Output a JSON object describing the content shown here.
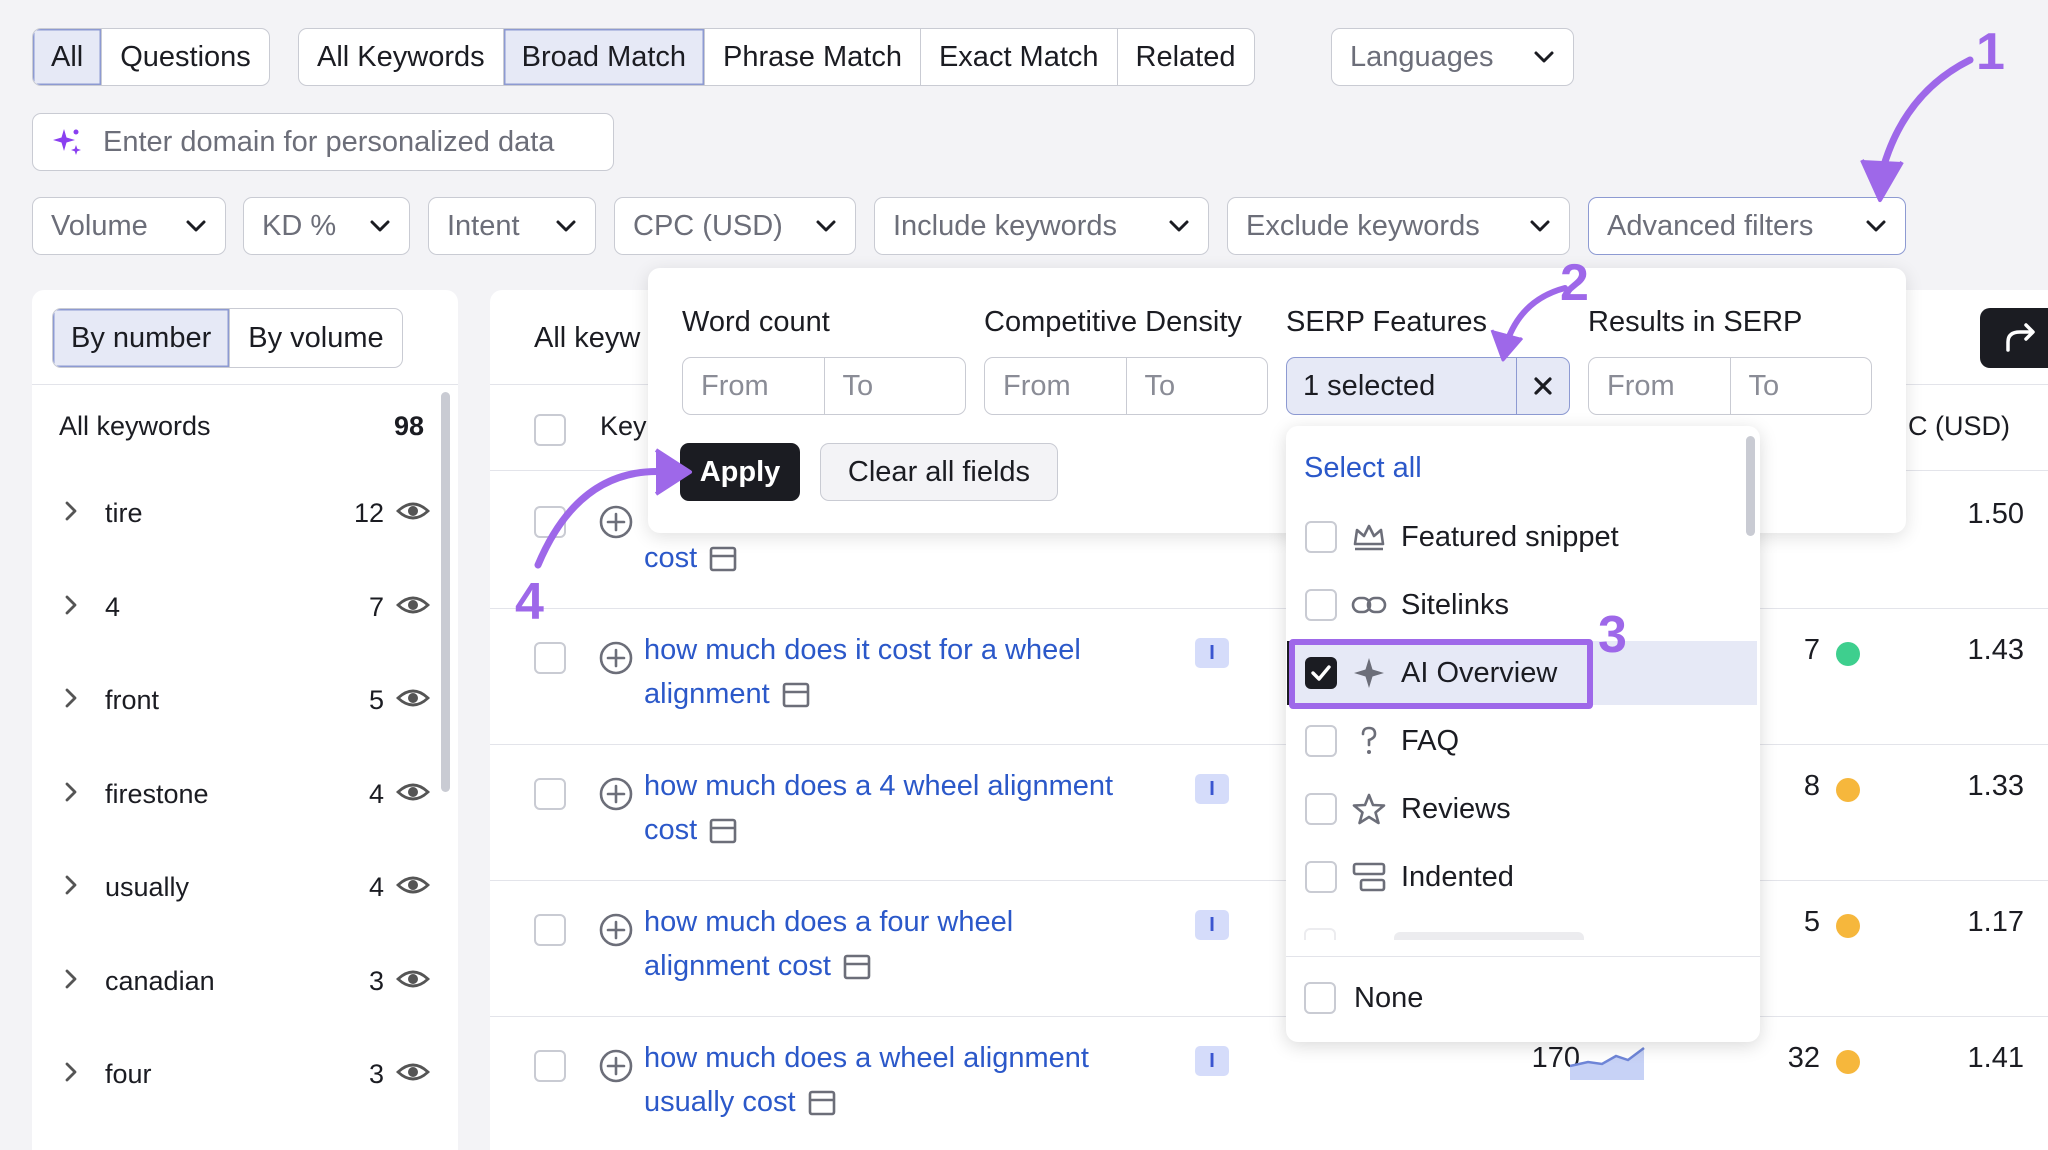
{
  "tabs_type": [
    "All",
    "Questions"
  ],
  "tabs_match": [
    "All Keywords",
    "Broad Match",
    "Phrase Match",
    "Exact Match",
    "Related"
  ],
  "languages": "Languages",
  "domain_placeholder": "Enter domain for personalized data",
  "filters": [
    "Volume",
    "KD %",
    "Intent",
    "CPC (USD)",
    "Include keywords",
    "Exclude keywords",
    "Advanced filters"
  ],
  "sidebar": {
    "by_number": "By number",
    "by_volume": "By volume",
    "all_label": "All keywords",
    "all_count": "98",
    "groups": [
      {
        "label": "tire",
        "count": "12"
      },
      {
        "label": "4",
        "count": "7"
      },
      {
        "label": "front",
        "count": "5"
      },
      {
        "label": "firestone",
        "count": "4"
      },
      {
        "label": "usually",
        "count": "4"
      },
      {
        "label": "canadian",
        "count": "3"
      },
      {
        "label": "four",
        "count": "3"
      }
    ]
  },
  "table": {
    "tab_label": "All keyw",
    "col_keyword": "Key",
    "col_cpc": "C (USD)",
    "rows": [
      {
        "kw1": "",
        "kw2": "cost",
        "intent": "",
        "kd": "",
        "cpc": "1.50"
      },
      {
        "kw1": "how much does it cost for a wheel",
        "kw2": "alignment",
        "intent": "I",
        "kd": "7",
        "cpc": "1.43"
      },
      {
        "kw1": "how much does a 4 wheel alignment",
        "kw2": "cost",
        "intent": "I",
        "kd": "8",
        "cpc": "1.33"
      },
      {
        "kw1": "how much does a four wheel",
        "kw2": "alignment cost",
        "intent": "I",
        "kd": "5",
        "cpc": "1.17"
      },
      {
        "kw1": "how much does a wheel alignment",
        "kw2": "usually cost",
        "intent": "I",
        "volume": "170",
        "kd": "32",
        "cpc": "1.41"
      }
    ]
  },
  "advanced": {
    "word_count": "Word count",
    "competitive_density": "Competitive Density",
    "serp_features": "SERP Features",
    "results_in_serp": "Results in SERP",
    "from": "From",
    "to": "To",
    "selected": "1 selected",
    "apply": "Apply",
    "clear": "Clear all fields"
  },
  "serp_list": {
    "select_all": "Select all",
    "items": [
      "Featured snippet",
      "Sitelinks",
      "AI Overview",
      "FAQ",
      "Reviews",
      "Indented"
    ],
    "none": "None"
  },
  "annotations": [
    "1",
    "2",
    "3",
    "4"
  ],
  "colors": {
    "accent": "#9e68e9",
    "link": "#2b58c9",
    "green": "#3ecf8e",
    "orange": "#f6b73c"
  }
}
